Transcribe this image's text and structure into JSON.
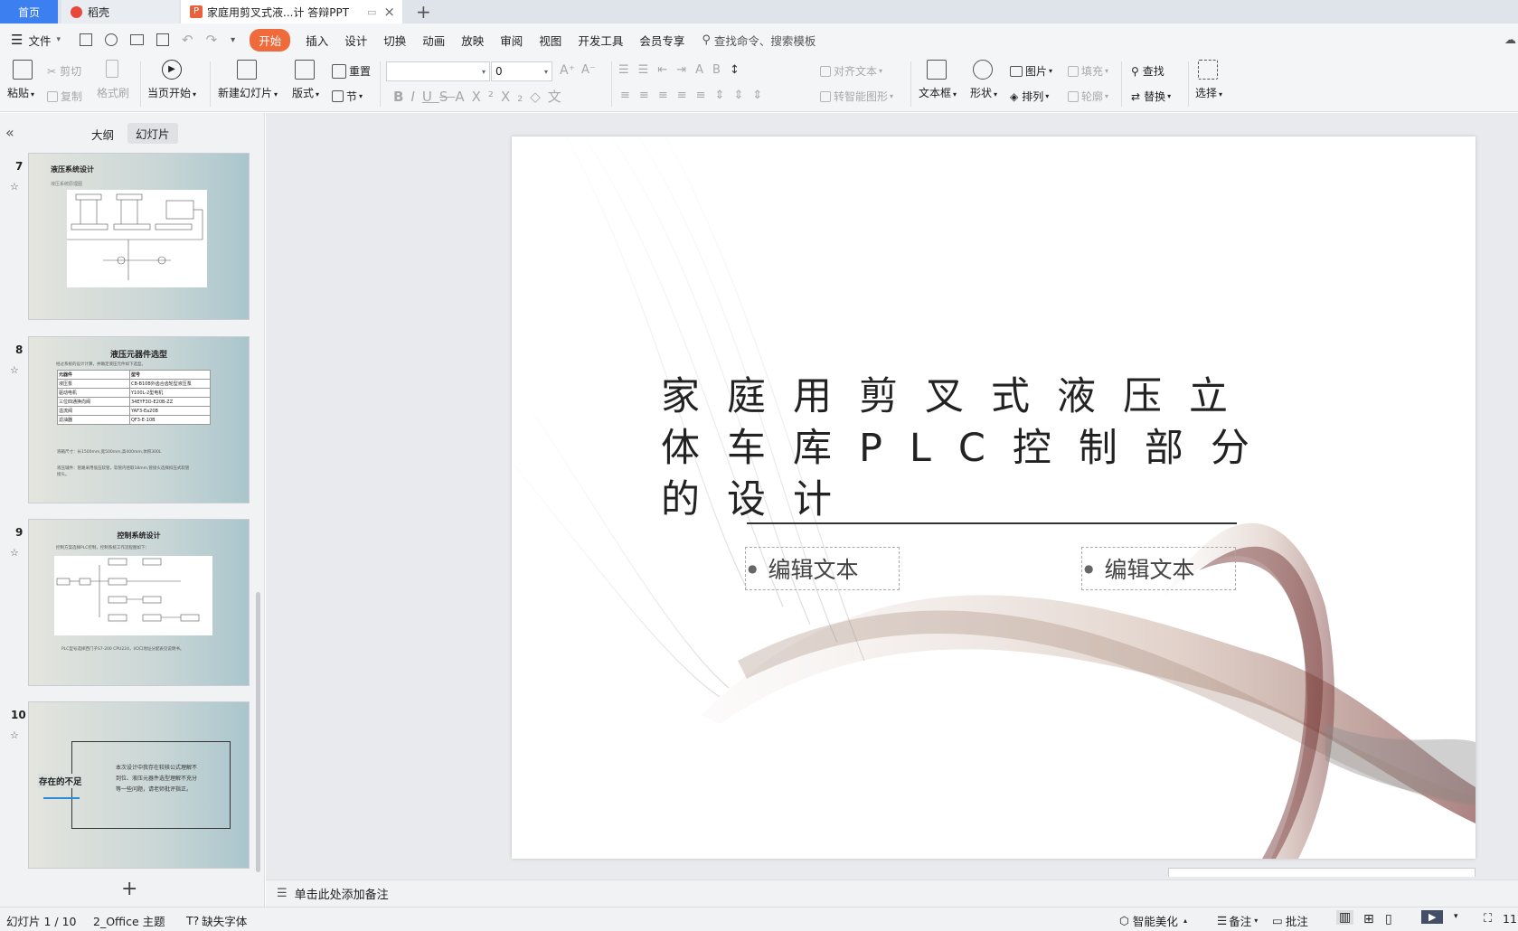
{
  "titlebar": {
    "tabs": [
      {
        "label": "首页"
      },
      {
        "label": "稻壳"
      },
      {
        "label": "家庭用剪叉式液...计 答辩PPT"
      }
    ],
    "new_tab": "+",
    "home_color": "#3c7ff1"
  },
  "menubar": {
    "file_label": "文件",
    "items": [
      "开始",
      "插入",
      "设计",
      "切换",
      "动画",
      "放映",
      "审阅",
      "视图",
      "开发工具",
      "会员专享"
    ],
    "search_placeholder": "查找命令、搜索模板",
    "active_color": "#ef6b3c"
  },
  "toolbar": {
    "paste": "粘贴",
    "cut": "剪切",
    "copy": "复制",
    "format_painter": "格式刷",
    "play_from_current": "当页开始",
    "new_slide": "新建幻灯片",
    "layout": "版式",
    "reset": "重置",
    "section": "节",
    "font_size_value": "0",
    "align_text": "对齐文本",
    "smartart": "转智能图形",
    "textbox": "文本框",
    "shape": "形状",
    "picture": "图片",
    "fill": "填充",
    "arrange": "排列",
    "outline": "轮廓",
    "find": "查找",
    "replace": "替换",
    "select": "选择"
  },
  "leftpanel": {
    "collapse": "«",
    "tab_outline": "大纲",
    "tab_slides": "幻灯片",
    "add": "+",
    "thumbs": [
      {
        "num": "7",
        "title": "液压系统设计",
        "subtitle": "液压系统原理图"
      },
      {
        "num": "8",
        "title": "液压元器件选型",
        "subtitle": "经过系统的设计计算，并确定液压元件如下选型。",
        "table": [
          [
            "元器件",
            "型号"
          ],
          [
            "液压泵",
            "CB-B10B外齿合齿轮型液压泵"
          ],
          [
            "驱动电机",
            "Y100L-2型电机"
          ],
          [
            "三位四通换向阀",
            "34EYF3O-E20B-ZZ"
          ],
          [
            "溢流阀",
            "YAF3-Ea20B"
          ],
          [
            "滤油器",
            "QF3-E-10B"
          ]
        ],
        "note1": "液箱尺寸：长1500mm,宽500mm,高400mm,体积300L",
        "note2": "液压辅件：管路采用低压软管，软管内径取18mm,管接头选择扣压式软管接头。"
      },
      {
        "num": "9",
        "title": "控制系统设计",
        "subtitle": "控制方案选择PLC控制，控制系统工作流程图如下：",
        "note": "PLC型号选择西门子S7-200 CPU224，I/O口地址分配表见说明书。"
      },
      {
        "num": "10",
        "heading": "存在的不足",
        "body": "本次设计中我存在较核公式理解不到位、液压元器件选型理解不充分等一些问题，请老师批评指正。"
      }
    ]
  },
  "slide": {
    "title": "家庭用剪叉式液压立体车库PLC控制部分的设计",
    "placeholders": [
      "编辑文本",
      "编辑文本"
    ]
  },
  "notes": {
    "placeholder": "单击此处添加备注"
  },
  "statusbar": {
    "slide_counter": "幻灯片 1 / 10",
    "theme": "2_Office 主题",
    "missing_font": "缺失字体",
    "beautify": "智能美化",
    "notes": "备注",
    "comments": "批注",
    "zoom": "11"
  }
}
